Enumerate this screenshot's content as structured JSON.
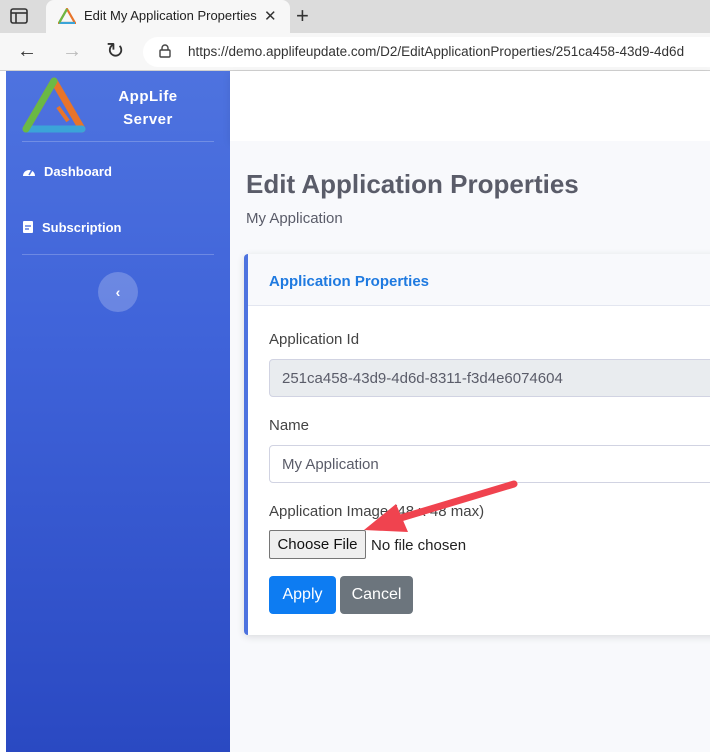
{
  "browser": {
    "tab_title": "Edit My Application Properties",
    "tab_close": "✕",
    "new_tab": "+",
    "url": "https://demo.applifeupdate.com/D2/EditApplicationProperties/251ca458-43d9-4d6d",
    "back_glyph": "←",
    "forward_glyph": "→",
    "reload_glyph": "↻"
  },
  "sidebar": {
    "brand_line1": "AppLife",
    "brand_line2": "Server",
    "items": [
      {
        "label": "Dashboard",
        "icon": "tachometer-icon"
      },
      {
        "label": "Subscription",
        "icon": "document-icon"
      }
    ],
    "toggle_glyph": "‹"
  },
  "page": {
    "title": "Edit Application Properties",
    "subtitle": "My Application"
  },
  "card": {
    "title": "Application Properties",
    "app_id_label": "Application Id",
    "app_id_value": "251ca458-43d9-4d6d-8311-f3d4e6074604",
    "name_label": "Name",
    "name_value": "My Application",
    "image_label": "Application Image (48 x 48 max)",
    "choose_file": "Choose File",
    "file_status": "No file chosen",
    "apply": "Apply",
    "cancel": "Cancel"
  },
  "colors": {
    "sidebar": "#4e73df",
    "accent": "#1f7ae0",
    "apply": "#0d7cf2",
    "cancel": "#6c757d",
    "annotation_arrow": "#f0434f"
  }
}
